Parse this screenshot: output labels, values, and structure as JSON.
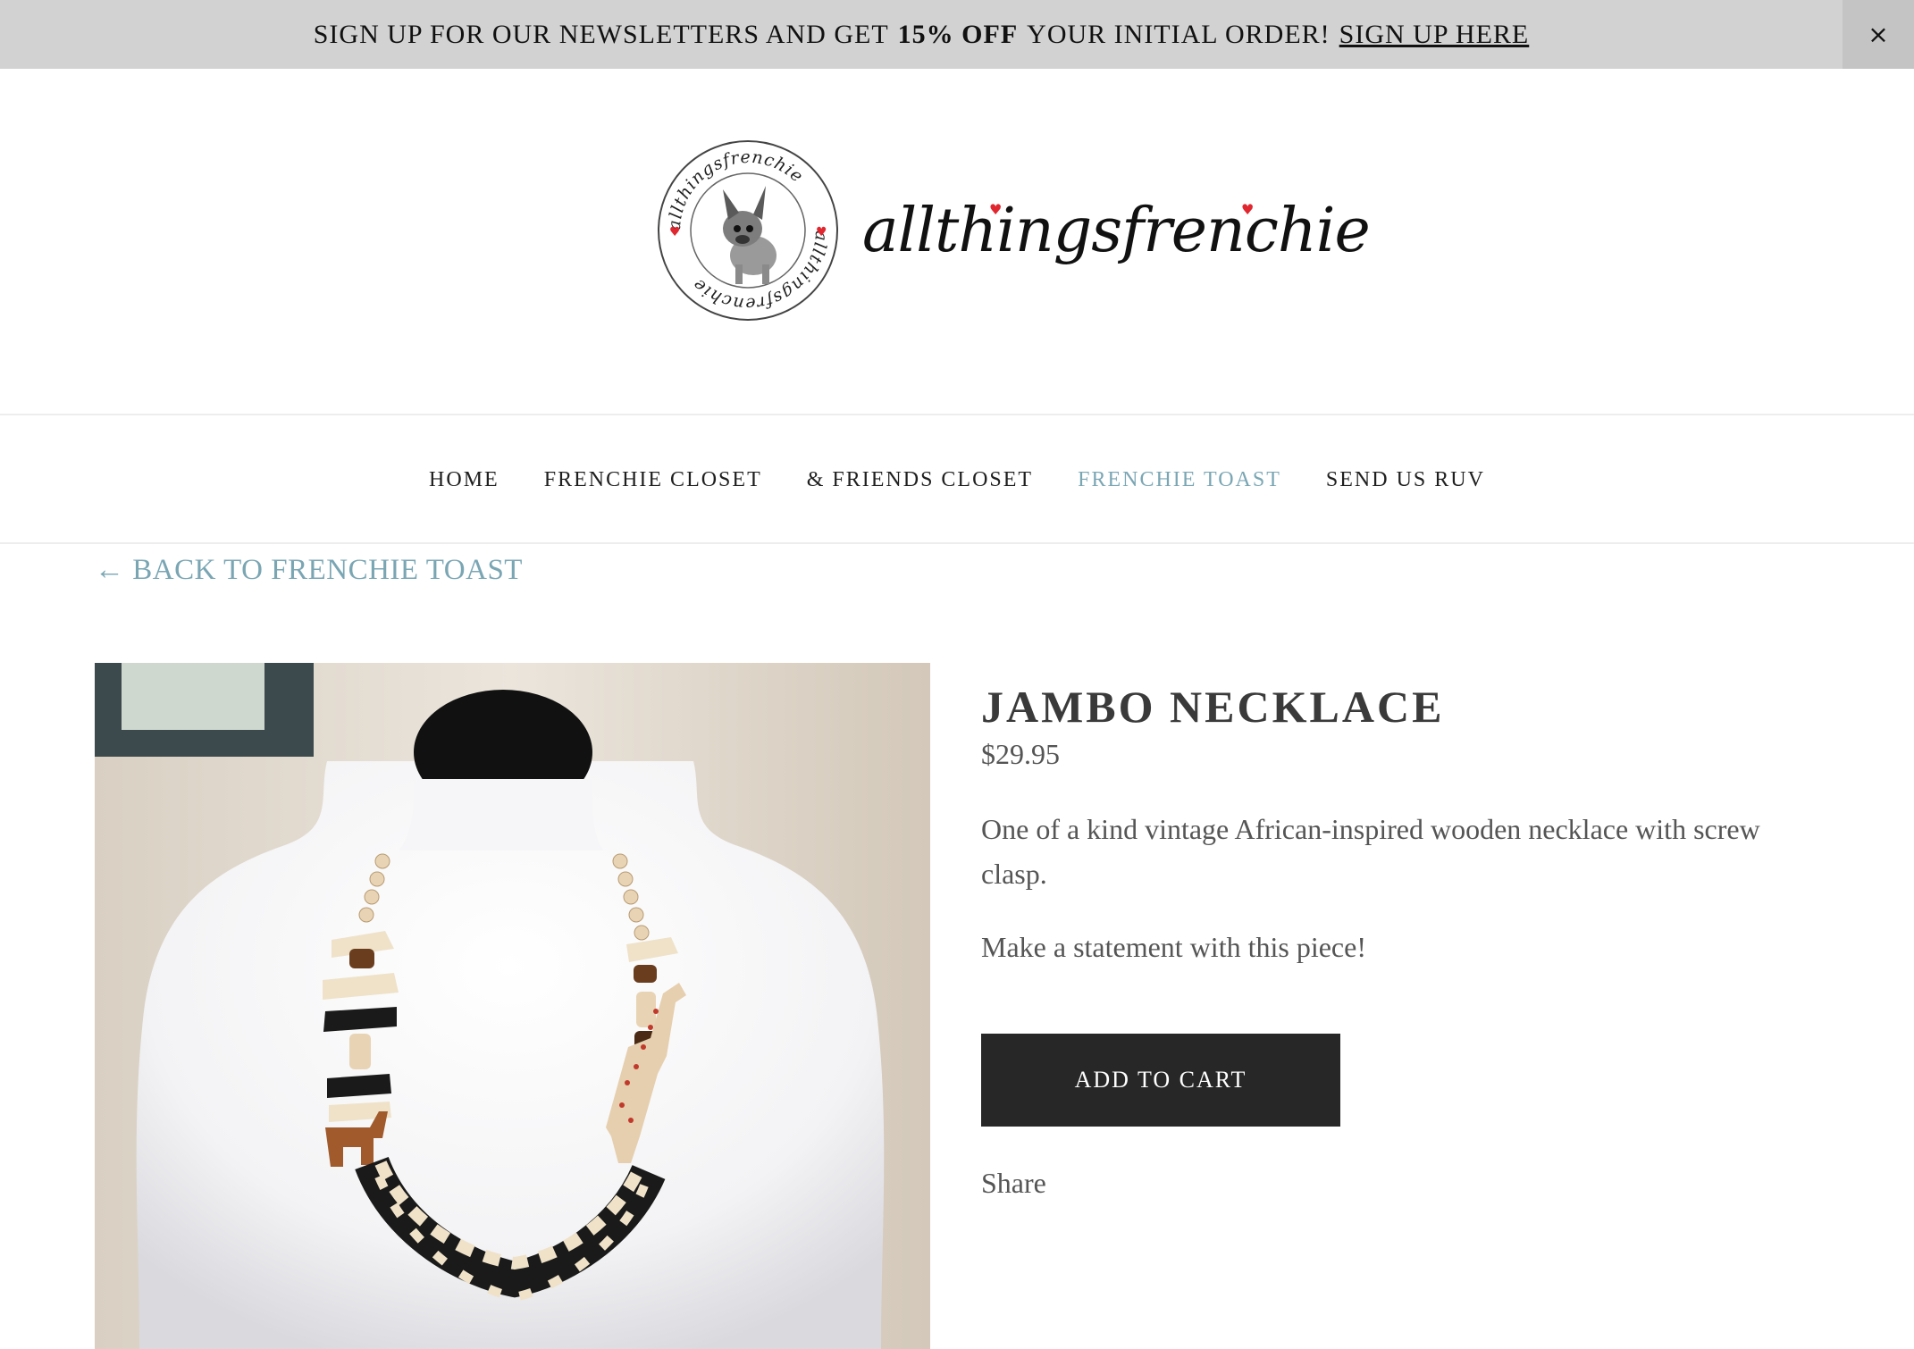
{
  "announcement": {
    "text_before": "Sign up for our newsletters and get",
    "discount": "15% off",
    "text_after": "your initial order!",
    "link_label": "Sign up here",
    "close_label": "×"
  },
  "brand": {
    "wordmark": "allthingsfrenchie",
    "seal_text": "allthingsfrenchie"
  },
  "nav": {
    "items": [
      {
        "label": "HOME",
        "active": false
      },
      {
        "label": "FRENCHIE CLOSET",
        "active": false
      },
      {
        "label": "& FRIENDS CLOSET",
        "active": false
      },
      {
        "label": "FRENCHIE TOAST",
        "active": true
      },
      {
        "label": "SEND US RUV",
        "active": false
      }
    ]
  },
  "back_link": "← BACK TO FRENCHIE TOAST",
  "product": {
    "title": "JAMBO NECKLACE",
    "price": "$29.95",
    "description": [
      "One of a kind vintage African-inspired wooden necklace with screw clasp.",
      "Make a statement with this piece!"
    ],
    "add_to_cart_label": "ADD TO CART",
    "share_label": "Share"
  },
  "colors": {
    "accent": "#7aa6b4",
    "button_bg": "#272727",
    "announcement_bg": "#d2d2d2",
    "heart": "#e0262f"
  }
}
